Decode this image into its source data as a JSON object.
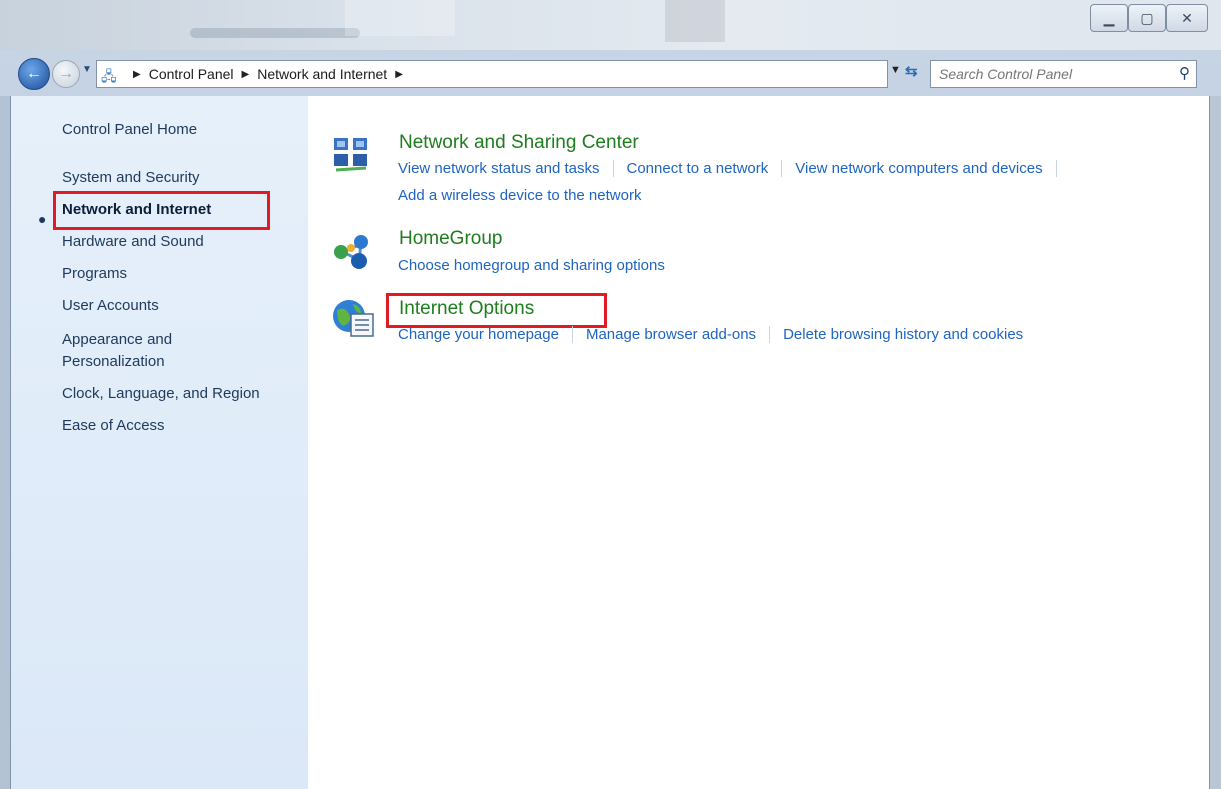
{
  "window": {
    "minimize_icon": "minimize-icon",
    "maximize_icon": "maximize-icon",
    "close_icon": "close-icon"
  },
  "navigation": {
    "breadcrumb": [
      "Control Panel",
      "Network and Internet"
    ],
    "search_placeholder": "Search Control Panel"
  },
  "sidebar": {
    "home": "Control Panel Home",
    "items": [
      "System and Security",
      "Network and Internet",
      "Hardware and Sound",
      "Programs",
      "User Accounts",
      "Appearance and",
      "Personalization",
      "Clock, Language, and Region",
      "Ease of Access"
    ],
    "current_index": 1
  },
  "categories": [
    {
      "title": "Network and Sharing Center",
      "icon": "network-sharing-icon",
      "links": [
        "View network status and tasks",
        "Connect to a network",
        "View network computers and devices"
      ],
      "links_row2": [
        "Add a wireless device to the network"
      ]
    },
    {
      "title": "HomeGroup",
      "icon": "homegroup-icon",
      "links": [
        "Choose homegroup and sharing options"
      ]
    },
    {
      "title": "Internet Options",
      "icon": "internet-options-icon",
      "links": [
        "Change your homepage",
        "Manage browser add-ons",
        "Delete browsing history and cookies"
      ]
    }
  ],
  "colors": {
    "highlight": "#e01b24",
    "category_title": "#1e7d1e",
    "link": "#1e64c0"
  }
}
